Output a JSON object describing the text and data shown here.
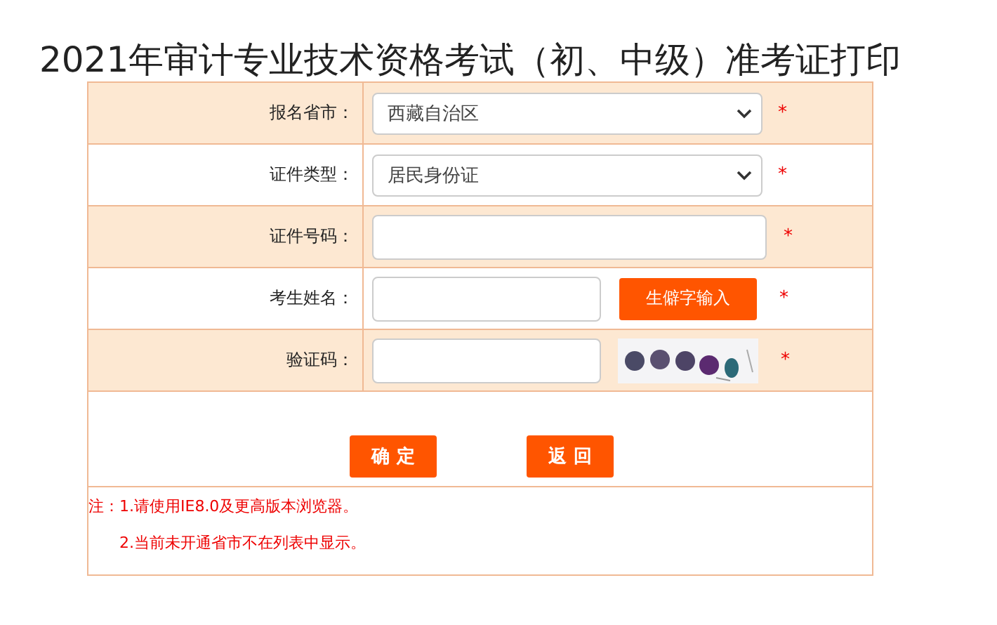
{
  "title": "2021年审计专业技术资格考试（初、中级）准考证打印",
  "rows": [
    {
      "label": "报名省市：",
      "kind": "select",
      "value": "西藏自治区",
      "required": "*"
    },
    {
      "label": "证件类型：",
      "kind": "select",
      "value": "居民身份证",
      "required": "*"
    },
    {
      "label": "证件号码：",
      "kind": "text",
      "required": "*"
    },
    {
      "label": "考生姓名：",
      "kind": "name",
      "button": "生僻字输入",
      "required": "*"
    },
    {
      "label": "验证码：",
      "kind": "captcha",
      "required": "*"
    }
  ],
  "buttons": [
    "确 定",
    "返 回"
  ],
  "notes": [
    "注：1.请使用IE8.0及更高版本浏览器。",
    "2.当前未开通省市不在列表中显示。"
  ]
}
